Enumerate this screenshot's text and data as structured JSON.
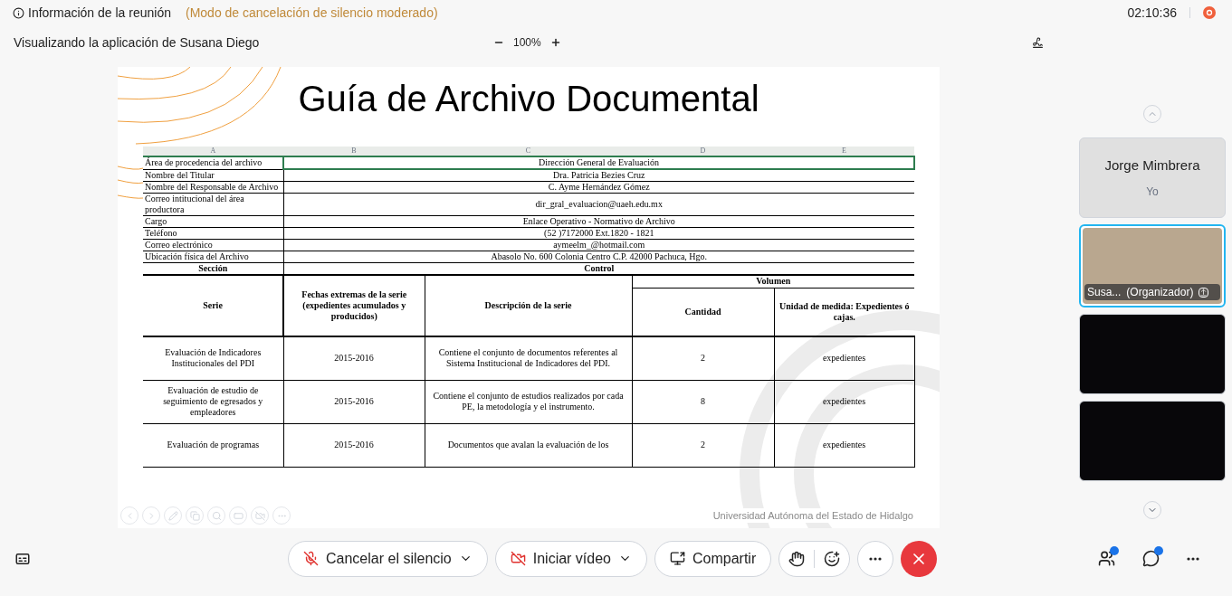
{
  "header": {
    "info_label": "Información de la reunión",
    "noise_mode": "(Modo de cancelación de silencio moderado)",
    "timer": "02:10:36"
  },
  "share_bar": {
    "viewing": "Visualizando la aplicación de Susana Diego",
    "zoom": "100%"
  },
  "slide": {
    "title": "Guía de Archivo Documental",
    "column_letters": [
      "A",
      "B",
      "C",
      "D",
      "E"
    ],
    "info_rows": [
      {
        "label": "Área de procedencia del archivo",
        "value": "Dirección General de Evaluación",
        "selected": true
      },
      {
        "label": "Nombre del Titular",
        "value": "Dra. Patricia Bezies Cruz",
        "selected": false
      },
      {
        "label": "Nombre del Responsable de Archivo",
        "value": "C. Ayme Hernández Gómez",
        "selected": false
      },
      {
        "label": "Correo intitucional del área productora",
        "value": "dir_gral_evaluacion@uaeh.edu.mx",
        "selected": false
      },
      {
        "label": "Cargo",
        "value": "Enlace Operativo - Normativo de Archivo",
        "selected": false
      },
      {
        "label": "Teléfono",
        "value": "(52 )7172000 Ext.1820 - 1821",
        "selected": false
      },
      {
        "label": "Correo electrónico",
        "value": "aymeelm_@hotmail.com",
        "selected": false
      },
      {
        "label": "Ubicación física del Archivo",
        "value": "Abasolo No. 600 Colonia Centro C.P. 42000 Pachuca, Hgo.",
        "selected": false
      }
    ],
    "section_row": {
      "left": "Sección",
      "right": "Control"
    },
    "columns": {
      "serie": "Serie",
      "fechas": "Fechas extremas de la serie (expedientes acumulados y producidos)",
      "descripcion": "Descripción de la serie",
      "volumen": "Volumen",
      "cantidad": "Cantidad",
      "unidad": "Unidad de medida: Expedientes ó cajas."
    },
    "rows": [
      {
        "serie": "Evaluación de Indicadores Institucionales del PDI",
        "fechas": "2015-2016",
        "descripcion": "Contiene el conjunto de documentos referentes al Sistema Institucional de Indicadores del PDI.",
        "cantidad": "2",
        "unidad": "expedientes"
      },
      {
        "serie": "Evaluación de estudio de seguimiento de egresados y empleadores",
        "fechas": "2015-2016",
        "descripcion": "Contiene el conjunto de estudios realizados por cada PE, la metodología y el instrumento.",
        "cantidad": "8",
        "unidad": "expedientes"
      },
      {
        "serie": "Evaluación de programas",
        "fechas": "2015-2016",
        "descripcion": "Documentos que avalan la evaluación de los",
        "cantidad": "2",
        "unidad": "expedientes"
      }
    ],
    "footer": "Universidad Autónoma del Estado de Hidalgo"
  },
  "participants": [
    {
      "kind": "self",
      "name": "Jorge Mimbrera",
      "caption": "Yo",
      "selected": false
    },
    {
      "kind": "video",
      "name": "Susa...",
      "role": "(Organizador)",
      "selected": true
    },
    {
      "kind": "blank",
      "selected": false
    },
    {
      "kind": "blank",
      "selected": false
    }
  ],
  "toolbar": {
    "mute": "Cancelar el silencio",
    "video": "Iniciar vídeo",
    "share": "Compartir",
    "participants_unread": true,
    "chat_unread": true
  }
}
